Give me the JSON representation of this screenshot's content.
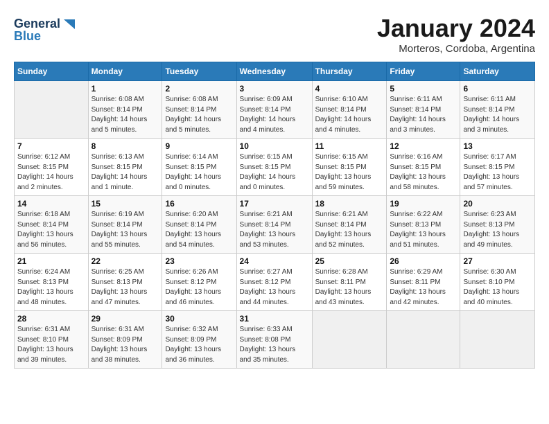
{
  "header": {
    "logo_line1": "General",
    "logo_line2": "Blue",
    "month": "January 2024",
    "location": "Morteros, Cordoba, Argentina"
  },
  "columns": [
    "Sunday",
    "Monday",
    "Tuesday",
    "Wednesday",
    "Thursday",
    "Friday",
    "Saturday"
  ],
  "weeks": [
    [
      {
        "day": "",
        "info": ""
      },
      {
        "day": "1",
        "info": "Sunrise: 6:08 AM\nSunset: 8:14 PM\nDaylight: 14 hours\nand 5 minutes."
      },
      {
        "day": "2",
        "info": "Sunrise: 6:08 AM\nSunset: 8:14 PM\nDaylight: 14 hours\nand 5 minutes."
      },
      {
        "day": "3",
        "info": "Sunrise: 6:09 AM\nSunset: 8:14 PM\nDaylight: 14 hours\nand 4 minutes."
      },
      {
        "day": "4",
        "info": "Sunrise: 6:10 AM\nSunset: 8:14 PM\nDaylight: 14 hours\nand 4 minutes."
      },
      {
        "day": "5",
        "info": "Sunrise: 6:11 AM\nSunset: 8:14 PM\nDaylight: 14 hours\nand 3 minutes."
      },
      {
        "day": "6",
        "info": "Sunrise: 6:11 AM\nSunset: 8:14 PM\nDaylight: 14 hours\nand 3 minutes."
      }
    ],
    [
      {
        "day": "7",
        "info": "Sunrise: 6:12 AM\nSunset: 8:15 PM\nDaylight: 14 hours\nand 2 minutes."
      },
      {
        "day": "8",
        "info": "Sunrise: 6:13 AM\nSunset: 8:15 PM\nDaylight: 14 hours\nand 1 minute."
      },
      {
        "day": "9",
        "info": "Sunrise: 6:14 AM\nSunset: 8:15 PM\nDaylight: 14 hours\nand 0 minutes."
      },
      {
        "day": "10",
        "info": "Sunrise: 6:15 AM\nSunset: 8:15 PM\nDaylight: 14 hours\nand 0 minutes."
      },
      {
        "day": "11",
        "info": "Sunrise: 6:15 AM\nSunset: 8:15 PM\nDaylight: 13 hours\nand 59 minutes."
      },
      {
        "day": "12",
        "info": "Sunrise: 6:16 AM\nSunset: 8:15 PM\nDaylight: 13 hours\nand 58 minutes."
      },
      {
        "day": "13",
        "info": "Sunrise: 6:17 AM\nSunset: 8:15 PM\nDaylight: 13 hours\nand 57 minutes."
      }
    ],
    [
      {
        "day": "14",
        "info": "Sunrise: 6:18 AM\nSunset: 8:14 PM\nDaylight: 13 hours\nand 56 minutes."
      },
      {
        "day": "15",
        "info": "Sunrise: 6:19 AM\nSunset: 8:14 PM\nDaylight: 13 hours\nand 55 minutes."
      },
      {
        "day": "16",
        "info": "Sunrise: 6:20 AM\nSunset: 8:14 PM\nDaylight: 13 hours\nand 54 minutes."
      },
      {
        "day": "17",
        "info": "Sunrise: 6:21 AM\nSunset: 8:14 PM\nDaylight: 13 hours\nand 53 minutes."
      },
      {
        "day": "18",
        "info": "Sunrise: 6:21 AM\nSunset: 8:14 PM\nDaylight: 13 hours\nand 52 minutes."
      },
      {
        "day": "19",
        "info": "Sunrise: 6:22 AM\nSunset: 8:13 PM\nDaylight: 13 hours\nand 51 minutes."
      },
      {
        "day": "20",
        "info": "Sunrise: 6:23 AM\nSunset: 8:13 PM\nDaylight: 13 hours\nand 49 minutes."
      }
    ],
    [
      {
        "day": "21",
        "info": "Sunrise: 6:24 AM\nSunset: 8:13 PM\nDaylight: 13 hours\nand 48 minutes."
      },
      {
        "day": "22",
        "info": "Sunrise: 6:25 AM\nSunset: 8:13 PM\nDaylight: 13 hours\nand 47 minutes."
      },
      {
        "day": "23",
        "info": "Sunrise: 6:26 AM\nSunset: 8:12 PM\nDaylight: 13 hours\nand 46 minutes."
      },
      {
        "day": "24",
        "info": "Sunrise: 6:27 AM\nSunset: 8:12 PM\nDaylight: 13 hours\nand 44 minutes."
      },
      {
        "day": "25",
        "info": "Sunrise: 6:28 AM\nSunset: 8:11 PM\nDaylight: 13 hours\nand 43 minutes."
      },
      {
        "day": "26",
        "info": "Sunrise: 6:29 AM\nSunset: 8:11 PM\nDaylight: 13 hours\nand 42 minutes."
      },
      {
        "day": "27",
        "info": "Sunrise: 6:30 AM\nSunset: 8:10 PM\nDaylight: 13 hours\nand 40 minutes."
      }
    ],
    [
      {
        "day": "28",
        "info": "Sunrise: 6:31 AM\nSunset: 8:10 PM\nDaylight: 13 hours\nand 39 minutes."
      },
      {
        "day": "29",
        "info": "Sunrise: 6:31 AM\nSunset: 8:09 PM\nDaylight: 13 hours\nand 38 minutes."
      },
      {
        "day": "30",
        "info": "Sunrise: 6:32 AM\nSunset: 8:09 PM\nDaylight: 13 hours\nand 36 minutes."
      },
      {
        "day": "31",
        "info": "Sunrise: 6:33 AM\nSunset: 8:08 PM\nDaylight: 13 hours\nand 35 minutes."
      },
      {
        "day": "",
        "info": ""
      },
      {
        "day": "",
        "info": ""
      },
      {
        "day": "",
        "info": ""
      }
    ]
  ]
}
